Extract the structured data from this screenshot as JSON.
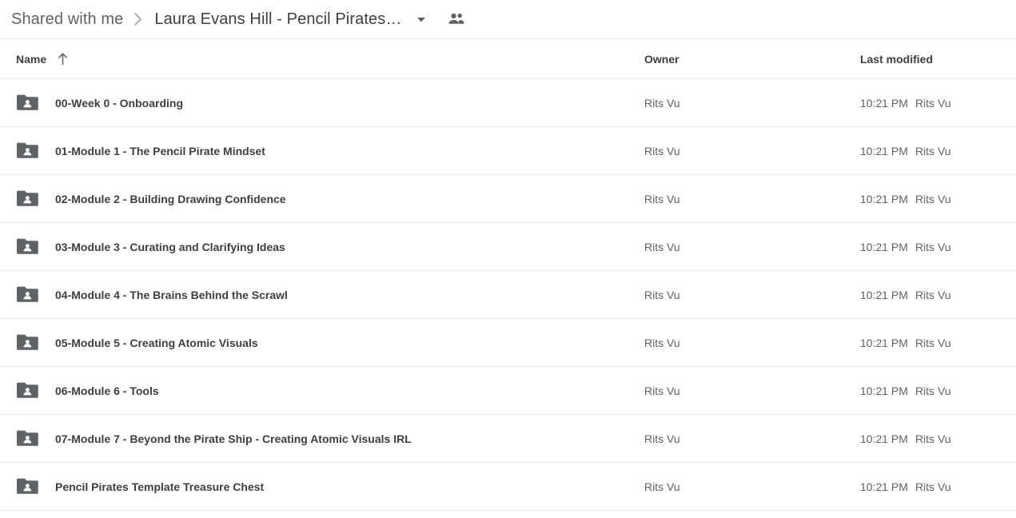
{
  "breadcrumb": {
    "root_label": "Shared with me",
    "separator_icon": "chevron-right-icon",
    "current_label": "Laura Evans Hill - Pencil Pirates…",
    "caret_icon": "caret-down-icon",
    "people_icon": "people-icon"
  },
  "columns": {
    "name": "Name",
    "sort_icon": "arrow-up-icon",
    "owner": "Owner",
    "last_modified": "Last modified"
  },
  "colors": {
    "text_primary": "#3c4043",
    "text_secondary": "#5f6368",
    "divider": "#e8eaed",
    "folder_icon": "#5f6368",
    "background": "#ffffff"
  },
  "rows": [
    {
      "icon": "shared-folder-icon",
      "name": "00-Week 0 - Onboarding",
      "owner": "Rits Vu",
      "modified_time": "10:21 PM",
      "modified_by": "Rits Vu"
    },
    {
      "icon": "shared-folder-icon",
      "name": "01-Module 1 - The Pencil Pirate Mindset",
      "owner": "Rits Vu",
      "modified_time": "10:21 PM",
      "modified_by": "Rits Vu"
    },
    {
      "icon": "shared-folder-icon",
      "name": "02-Module 2 - Building Drawing Confidence",
      "owner": "Rits Vu",
      "modified_time": "10:21 PM",
      "modified_by": "Rits Vu"
    },
    {
      "icon": "shared-folder-icon",
      "name": "03-Module 3 - Curating and Clarifying Ideas",
      "owner": "Rits Vu",
      "modified_time": "10:21 PM",
      "modified_by": "Rits Vu"
    },
    {
      "icon": "shared-folder-icon",
      "name": "04-Module 4 - The Brains Behind the Scrawl",
      "owner": "Rits Vu",
      "modified_time": "10:21 PM",
      "modified_by": "Rits Vu"
    },
    {
      "icon": "shared-folder-icon",
      "name": "05-Module 5 - Creating Atomic Visuals",
      "owner": "Rits Vu",
      "modified_time": "10:21 PM",
      "modified_by": "Rits Vu"
    },
    {
      "icon": "shared-folder-icon",
      "name": "06-Module 6 - Tools",
      "owner": "Rits Vu",
      "modified_time": "10:21 PM",
      "modified_by": "Rits Vu"
    },
    {
      "icon": "shared-folder-icon",
      "name": "07-Module 7 - Beyond the Pirate Ship - Creating Atomic Visuals IRL",
      "owner": "Rits Vu",
      "modified_time": "10:21 PM",
      "modified_by": "Rits Vu"
    },
    {
      "icon": "shared-folder-icon",
      "name": "Pencil Pirates Template Treasure Chest",
      "owner": "Rits Vu",
      "modified_time": "10:21 PM",
      "modified_by": "Rits Vu"
    }
  ]
}
